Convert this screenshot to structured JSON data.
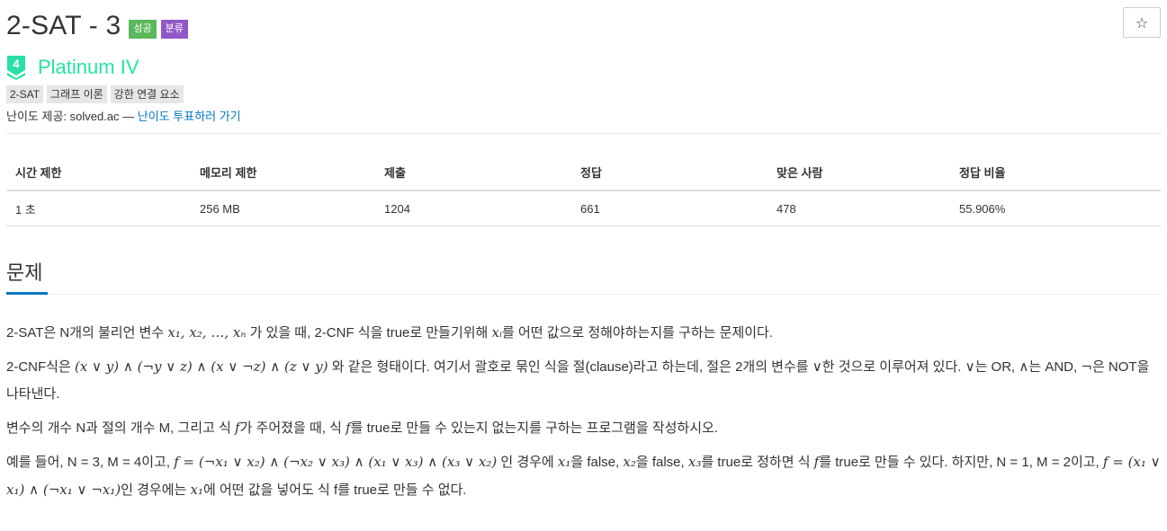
{
  "problem": {
    "title": "2-SAT - 3",
    "badge_success": "성공",
    "badge_category": "분류",
    "star_icon": "☆",
    "tier_number": "4",
    "tier_name": "Platinum IV",
    "tier_color": "#27e2a4",
    "tags": [
      "2-SAT",
      "그래프 이론",
      "강한 연결 요소"
    ],
    "provider_label": "난이도 제공: solved.ac — ",
    "provider_link": "난이도 투표하러 가기"
  },
  "stats": {
    "headers": [
      "시간 제한",
      "메모리 제한",
      "제출",
      "정답",
      "맞은 사람",
      "정답 비율"
    ],
    "values": [
      "1 초",
      "256 MB",
      "1204",
      "661",
      "478",
      "55.906%"
    ]
  },
  "section": {
    "title": "문제"
  },
  "description": {
    "p1": {
      "a": "2-SAT은 N개의 불리언 변수 ",
      "math1": "x₁, x₂, …, xₙ",
      "b": " 가 있을 때, 2-CNF 식을 true로 만들기위해 ",
      "math2": "xᵢ",
      "c": "를 어떤 값으로 정해야하는지를 구하는 문제이다."
    },
    "p2": {
      "a": "2-CNF식은 ",
      "math1": "(x ∨ y) ∧ (¬y ∨ z) ∧ (x ∨ ¬z) ∧ (z ∨ y)",
      "b": " 와 같은 형태이다. 여기서 괄호로 묶인 식을 절(clause)라고 하는데, 절은 2개의 변수를 ",
      "or1": "∨",
      "c": "한 것으로 이루어져 있다. ",
      "or2": "∨",
      "d": "는 OR, ",
      "and1": "∧",
      "e": "는 AND, ",
      "not1": "¬",
      "f": "은 NOT을 나타낸다."
    },
    "p3": {
      "a": "변수의 개수 N과 절의 개수 M, 그리고 식 ",
      "math1": "f",
      "b": "가 주어졌을 때, 식 ",
      "math2": "f",
      "c": "를 true로 만들 수 있는지 없는지를 구하는 프로그램을 작성하시오."
    },
    "p4": {
      "a": "예를 들어, N = 3, M = 4이고, ",
      "math1": "f = (¬x₁ ∨ x₂) ∧ (¬x₂ ∨ x₃) ∧ (x₁ ∨ x₃) ∧ (x₃ ∨ x₂)",
      "b": " 인 경우에 ",
      "math2": "x₁",
      "c": "을 false, ",
      "math3": "x₂",
      "d": "을 false, ",
      "math4": "x₃",
      "e": "를 true로 정하면 식 ",
      "math5": "f",
      "f": "를 true로 만들 수 있다. 하지만, N = 1, M = 2이고, ",
      "math6": "f = (x₁ ∨ x₁) ∧ (¬x₁ ∨ ¬x₁)",
      "g": "인 경우에는 ",
      "math7": "x₁",
      "h": "에 어떤 값을 넣어도 식 f를 true로 만들 수 없다."
    }
  }
}
